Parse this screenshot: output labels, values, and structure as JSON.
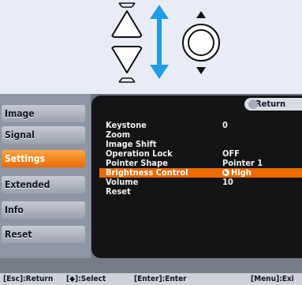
{
  "sidebar": {
    "items": [
      {
        "label": "Image"
      },
      {
        "label": "Signal"
      },
      {
        "label": "Settings"
      },
      {
        "label": "Extended"
      },
      {
        "label": "Info"
      },
      {
        "label": "Reset"
      }
    ],
    "active": "Settings"
  },
  "panel": {
    "return_label": "Return",
    "rows": [
      {
        "label": "Keystone",
        "value": "0"
      },
      {
        "label": "Zoom",
        "value": ""
      },
      {
        "label": "Image Shift",
        "value": ""
      },
      {
        "label": "Operation Lock",
        "value": "OFF"
      },
      {
        "label": "Pointer Shape",
        "value": "Pointer 1"
      },
      {
        "label": "Brightness Control",
        "value": "High"
      },
      {
        "label": "Volume",
        "value": "10"
      },
      {
        "label": "Reset",
        "value": ""
      }
    ],
    "highlighted": "Brightness Control"
  },
  "statusbar": {
    "esc": "[Esc]:Return",
    "select": "[◆]:Select",
    "enter": "[Enter]:Enter",
    "menu": "[Menu]:Exi"
  },
  "icons": {
    "keystone_buttons": "keystone-up-down-icon",
    "arrow": "up-down-arrow-icon",
    "dial": "up-down-dial-icon"
  },
  "colors": {
    "accent": "#ec6a00",
    "arrow": "#1f9ce6",
    "panel": "#121416",
    "sidebar": "#8f95a3"
  }
}
